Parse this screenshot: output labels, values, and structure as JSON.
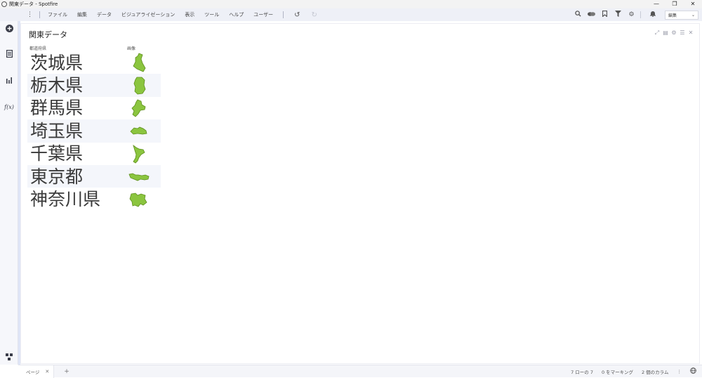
{
  "window": {
    "title": "関東データ - Spotfire",
    "controls": [
      "—",
      "❐",
      "✕"
    ]
  },
  "menu": {
    "items": [
      "ファイル",
      "編集",
      "データ",
      "ビジュアライゼーション",
      "表示",
      "ツール",
      "ヘルプ",
      "ユーザー"
    ],
    "mode": "編集"
  },
  "panel": {
    "title": "関東データ",
    "columns": [
      "都道府県",
      "画像"
    ],
    "rows": [
      {
        "name": "茨城県",
        "map": "ibaraki"
      },
      {
        "name": "栃木県",
        "map": "tochigi"
      },
      {
        "name": "群馬県",
        "map": "gunma"
      },
      {
        "name": "埼玉県",
        "map": "saitama"
      },
      {
        "name": "千葉県",
        "map": "chiba"
      },
      {
        "name": "東京都",
        "map": "tokyo"
      },
      {
        "name": "神奈川県",
        "map": "kanagawa"
      }
    ],
    "map_color": "#8bc53f",
    "map_stroke": "#5e8f1d"
  },
  "status": {
    "page_tab": "ページ",
    "rows": "7 ローの 7",
    "marking": "0 をマーキング",
    "columns": "2 個のカラム"
  }
}
